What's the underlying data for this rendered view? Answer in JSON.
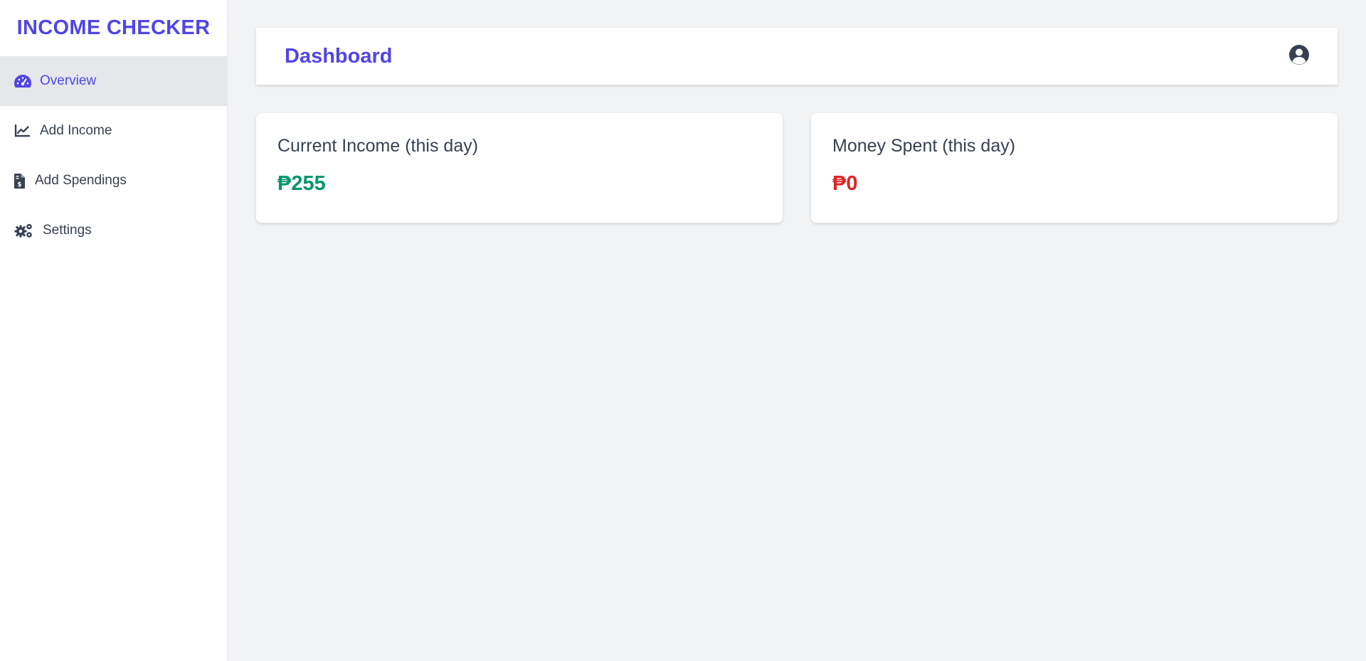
{
  "app": {
    "brand": "INCOME CHECKER"
  },
  "sidebar": {
    "items": [
      {
        "label": "Overview",
        "icon": "gauge-icon",
        "active": true
      },
      {
        "label": "Add Income",
        "icon": "line-chart-icon",
        "active": false
      },
      {
        "label": "Add Spendings",
        "icon": "file-invoice-dollar-icon",
        "active": false
      },
      {
        "label": "Settings",
        "icon": "gears-icon",
        "active": false
      }
    ]
  },
  "header": {
    "title": "Dashboard",
    "user_icon": "user-circle-icon"
  },
  "cards": [
    {
      "title": "Current Income (this day)",
      "value": "₱255",
      "color": "#059669"
    },
    {
      "title": "Money Spent (this day)",
      "value": "₱0",
      "color": "#dc2626"
    }
  ],
  "colors": {
    "accent": "#4f46e5",
    "text": "#374151",
    "background": "#f2f3f5",
    "income": "#059669",
    "spent": "#dc2626"
  }
}
